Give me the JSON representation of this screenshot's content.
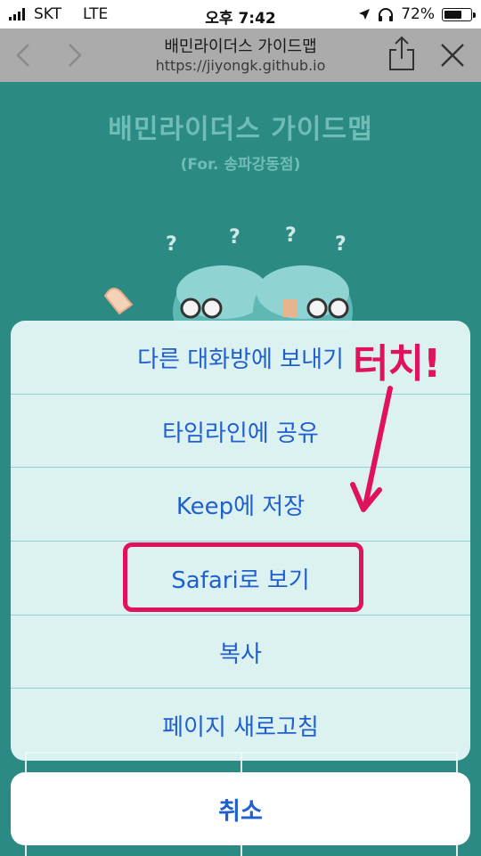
{
  "status_bar": {
    "carrier": "SKT",
    "network": "LTE",
    "time": "오후 7:42",
    "battery_percent": "72%",
    "battery_level": 0.72,
    "icons": [
      "signal-icon",
      "location-icon",
      "headphones-icon",
      "battery-icon"
    ]
  },
  "browser": {
    "page_title": "배민라이더스 가이드맵",
    "url": "https://jiyongk.github.io",
    "icons": [
      "back-icon",
      "forward-icon",
      "share-icon",
      "close-icon"
    ]
  },
  "page": {
    "title": "배민라이더스 가이드맵",
    "subtitle": "(For. 송파강동점)",
    "question_marks": [
      "?",
      "?",
      "?",
      "?"
    ],
    "colors": {
      "background": "#2b8a83",
      "title": "#6fbdb6"
    }
  },
  "action_sheet": {
    "items": [
      {
        "label": "다른 대화방에 보내기"
      },
      {
        "label": "타임라인에 공유"
      },
      {
        "label": "Keep에 저장"
      },
      {
        "label": "Safari로 보기"
      },
      {
        "label": "복사"
      },
      {
        "label": "페이지 새로고침"
      }
    ],
    "cancel_label": "취소",
    "colors": {
      "text": "#1f5fd0",
      "divider": "#8cd2d4"
    }
  },
  "annotation": {
    "label": "터치!",
    "color": "#e0125e"
  }
}
